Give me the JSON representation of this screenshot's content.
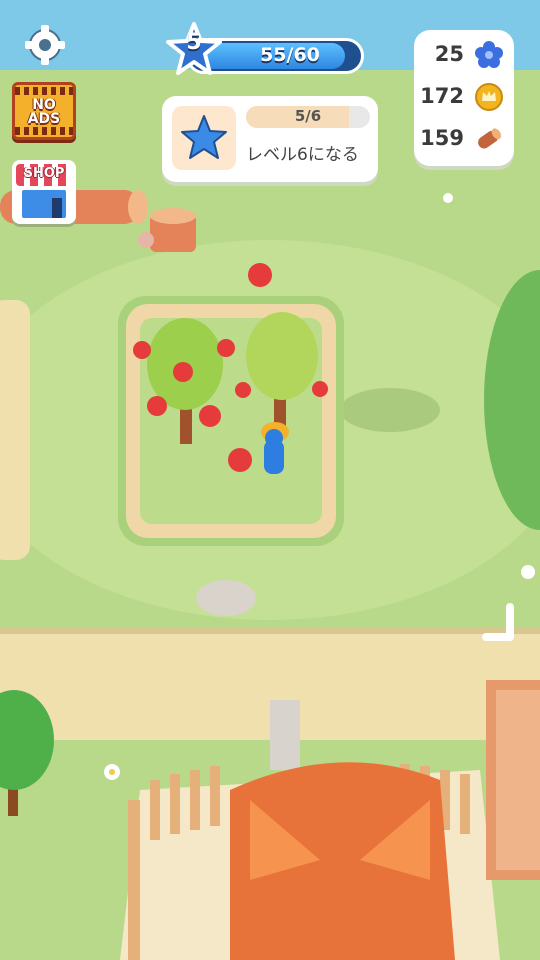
{
  "hud": {
    "level": {
      "number": "5",
      "xp_text": "55/60",
      "progress": 0.9167
    },
    "quest": {
      "progress_text": "5/6",
      "progress": 0.8333,
      "title": "レベル6になる"
    },
    "resources": {
      "flowers": "25",
      "coins": "172",
      "logs": "159"
    },
    "no_ads": {
      "line1": "NO",
      "line2": "ADS"
    },
    "shop": {
      "label": "SHOP"
    }
  },
  "icons": {
    "settings": "gear-icon",
    "level": "star-icon",
    "quest": "star-icon",
    "flowers": "blue-flower-icon",
    "coins": "crown-coin-icon",
    "logs": "wood-log-icon"
  },
  "colors": {
    "grass": "#b9d98a",
    "path": "#f2e3b4",
    "level_blue": "#2e86e0",
    "roof": "#e8733a",
    "apple": "#e53b3b"
  }
}
